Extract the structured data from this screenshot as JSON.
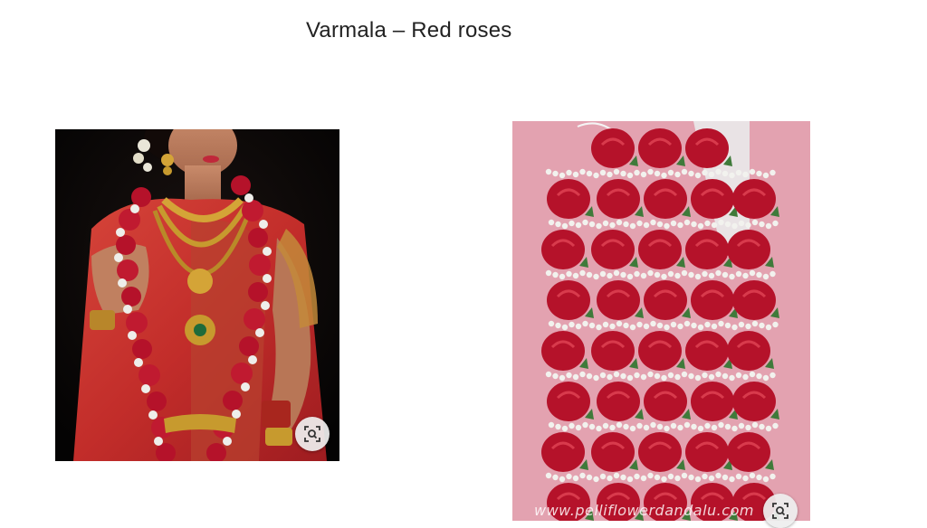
{
  "slide": {
    "title": "Varmala – Red roses"
  },
  "images": {
    "left": {
      "subject": "bride in red silk saree with gold jewellery wearing red rose garland",
      "action_icon": "visual-search-icon"
    },
    "right": {
      "subject": "rows of red roses with white gypsophila on pink background",
      "watermark": "www.pelliflowerdandalu.com",
      "action_icon": "visual-search-icon"
    }
  },
  "colors": {
    "rose_red": "#b5122a",
    "gypsophila_white": "#f2f2ee",
    "backdrop_pink": "#e6a7b4",
    "saree_red": "#c8362e",
    "gold": "#c79a2e"
  }
}
